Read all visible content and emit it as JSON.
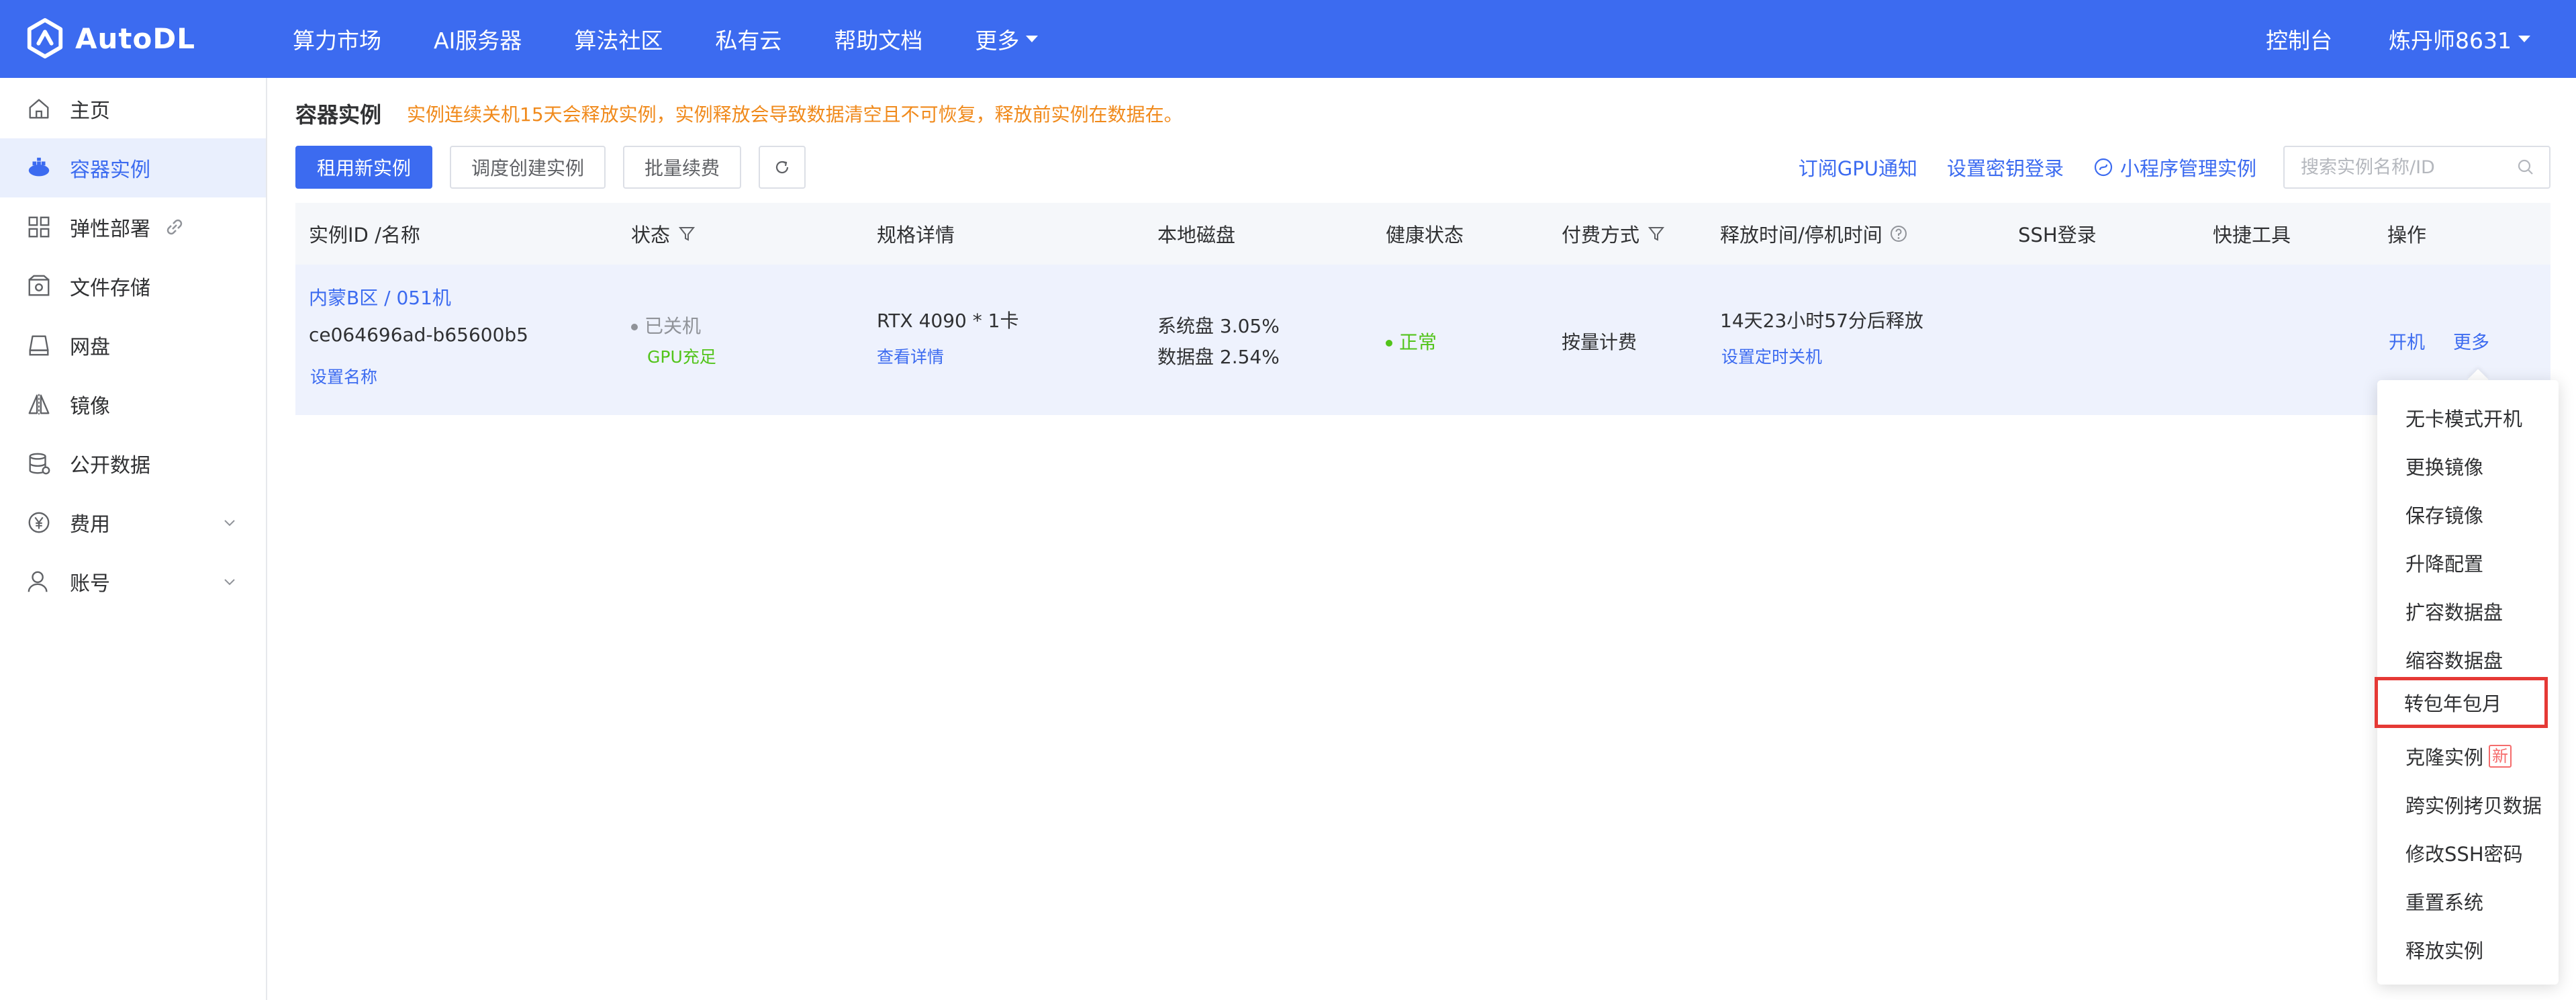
{
  "brand": {
    "name": "AutoDL"
  },
  "topnav": {
    "items": [
      "算力市场",
      "AI服务器",
      "算法社区",
      "私有云",
      "帮助文档"
    ],
    "more_label": "更多",
    "console_label": "控制台",
    "user_label": "炼丹师8631"
  },
  "sidebar": {
    "items": [
      {
        "label": "主页"
      },
      {
        "label": "容器实例"
      },
      {
        "label": "弹性部署"
      },
      {
        "label": "文件存储"
      },
      {
        "label": "网盘"
      },
      {
        "label": "镜像"
      },
      {
        "label": "公开数据"
      },
      {
        "label": "费用"
      },
      {
        "label": "账号"
      }
    ]
  },
  "page": {
    "title": "容器实例",
    "warning": "实例连续关机15天会释放实例，实例释放会导致数据清空且不可恢复，释放前实例在数据在。"
  },
  "toolbar": {
    "rent_new": "租用新实例",
    "schedule_create": "调度创建实例",
    "batch_renew": "批量续费",
    "subscribe_gpu": "订阅GPU通知",
    "set_key_login": "设置密钥登录",
    "mini_program": "小程序管理实例",
    "search_placeholder": "搜索实例名称/ID"
  },
  "table": {
    "headers": {
      "id_name": "实例ID /名称",
      "status": "状态",
      "spec": "规格详情",
      "disk": "本地磁盘",
      "health": "健康状态",
      "billing": "付费方式",
      "release": "释放时间/停机时间",
      "ssh": "SSH登录",
      "tools": "快捷工具",
      "ops": "操作"
    },
    "row": {
      "region_name": "内蒙B区 / 051机",
      "instance_id": "ce064696ad-b65600b5",
      "set_name": "设置名称",
      "status": "已关机",
      "gpu_status": "GPU充足",
      "gpu_spec": "RTX 4090 * 1卡",
      "view_detail": "查看详情",
      "system_disk": "系统盘 3.05%",
      "data_disk": "数据盘 2.54%",
      "health": "正常",
      "billing": "按量计费",
      "release_time": "14天23小时57分后释放",
      "set_shutdown": "设置定时关机",
      "op_start": "开机",
      "op_more": "更多"
    }
  },
  "dropdown": {
    "items": [
      "无卡模式开机",
      "更换镜像",
      "保存镜像",
      "升降配置",
      "扩容数据盘",
      "缩容数据盘",
      "转包年包月",
      "克隆实例",
      "跨实例拷贝数据",
      "修改SSH密码",
      "重置系统",
      "释放实例"
    ],
    "new_badge": "新",
    "highlighted": "转包年包月"
  },
  "colors": {
    "primary": "#3c6bf0",
    "warning": "#f08a1c",
    "success": "#52c41a",
    "highlight_border": "#e53935"
  }
}
